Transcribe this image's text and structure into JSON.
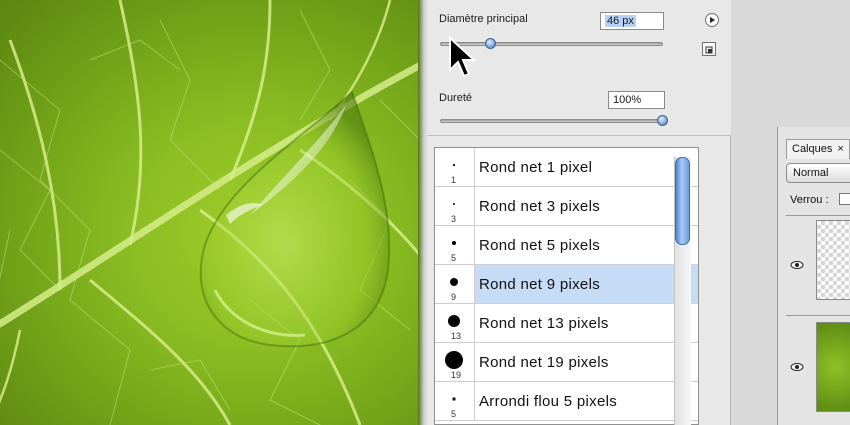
{
  "brush_panel": {
    "diameter_label": "Diamètre principal",
    "diameter_value": "46 px",
    "hardness_label": "Dureté",
    "hardness_value": "100%",
    "diameter_slider_fraction": 0.23,
    "hardness_slider_fraction": 1.0,
    "menu_icon": "play-triangle-icon",
    "new_preset_icon": "new-preset-icon"
  },
  "brushes": [
    {
      "name": "Rond net 1 pixel",
      "size": "1",
      "kind": "hard",
      "selected": false
    },
    {
      "name": "Rond net 3 pixels",
      "size": "3",
      "kind": "hard",
      "selected": false
    },
    {
      "name": "Rond net 5 pixels",
      "size": "5",
      "kind": "hard",
      "selected": false
    },
    {
      "name": "Rond net 9 pixels",
      "size": "9",
      "kind": "hard",
      "selected": true
    },
    {
      "name": "Rond net 13 pixels",
      "size": "13",
      "kind": "hard",
      "selected": false
    },
    {
      "name": "Rond net 19 pixels",
      "size": "19",
      "kind": "hard",
      "selected": false
    },
    {
      "name": "Arrondi flou 5 pixels",
      "size": "5",
      "kind": "soft",
      "selected": false
    }
  ],
  "layers_panel": {
    "tab_label": "Calques",
    "tab_close": "×",
    "blend_mode": "Normal",
    "lock_label": "Verrou :"
  },
  "colors": {
    "selection": "#c6dbf6",
    "leaf": "#8abd22",
    "accent": "#4f86cf"
  }
}
